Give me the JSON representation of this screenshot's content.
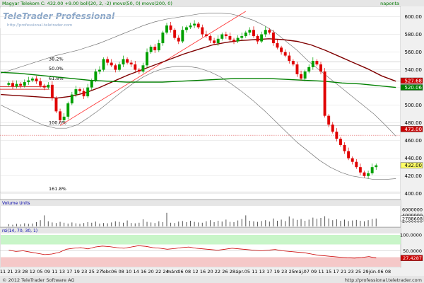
{
  "header": {
    "main_label": "Magyar Telekom C: 432.00 +9.00 boll(20, 2, -2) movs(50, 0) movs(200, 0)",
    "period": "naponta"
  },
  "watermark": {
    "brand": "TeleTrader Professional",
    "url": "http://professional.teletrader.com"
  },
  "panels": {
    "volume_label": "Volume Units",
    "rsi_label": "rsi(14, 70, 30, 1)"
  },
  "footer": {
    "copyright": "© 2012 TeleTrader Software AG",
    "url": "http://professional.teletrader.com"
  },
  "fib": [
    {
      "label": "38.2%",
      "value": 549
    },
    {
      "label": "50.0%",
      "value": 538
    },
    {
      "label": "61.8%",
      "value": 527
    },
    {
      "label": "100.0%",
      "value": 477
    },
    {
      "label": "161.8%",
      "value": 402
    }
  ],
  "value_tags": [
    {
      "label": "527.68",
      "value": 527.68,
      "color": "#cc0000"
    },
    {
      "label": "520.06",
      "value": 520.06,
      "color": "#008000"
    },
    {
      "label": "473.00",
      "value": 473.0,
      "color": "#cc0000"
    },
    {
      "label": "432.00",
      "value": 432.0,
      "color": "#ffff66"
    }
  ],
  "volume_tag": {
    "label": "2788608",
    "value": 2788608
  },
  "rsi_tag": {
    "label": "27.4287",
    "value": 27.43
  },
  "colors": {
    "up": "#00a000",
    "down": "#e00000",
    "ma50": "#800000",
    "ma200": "#008000",
    "bollinger": "#777777",
    "trend": "#ff3333",
    "rsi_band_high": "#c8f5c8",
    "rsi_band_low": "#f5c8c8"
  },
  "x_axis_labels": [
    "11",
    "21",
    "23",
    "28",
    "12",
    "05",
    "09",
    "11",
    "13",
    "17",
    "19",
    "23",
    "25",
    "27",
    "febr.",
    "06",
    "08",
    "10",
    "14",
    "16",
    "20",
    "22",
    "24",
    "márc.",
    "06",
    "08",
    "12",
    "16",
    "20",
    "22",
    "26",
    "28",
    "ápr.",
    "05",
    "11",
    "13",
    "17",
    "19",
    "23",
    "25",
    "máj.",
    "07",
    "09",
    "11",
    "15",
    "17",
    "21",
    "23",
    "25",
    "29",
    "jún.",
    "06",
    "08"
  ],
  "chart_data": [
    {
      "type": "candlestick",
      "title": "Magyar Telekom C: 432.00 +9.00 boll(20, 2, -2) movs(50, 0) movs(200, 0)",
      "ylim": [
        395,
        610
      ],
      "yticks": [
        400,
        420,
        440,
        460,
        480,
        500,
        520,
        540,
        560,
        580,
        600
      ],
      "close": [
        525,
        521,
        524,
        522,
        526,
        528,
        530,
        527,
        522,
        520,
        523,
        508,
        493,
        483,
        487,
        502,
        512,
        518,
        516,
        510,
        520,
        528,
        538,
        540,
        552,
        548,
        545,
        540,
        546,
        552,
        548,
        546,
        540,
        538,
        545,
        560,
        566,
        562,
        570,
        582,
        590,
        585,
        576,
        572,
        585,
        588,
        590,
        592,
        588,
        580,
        578,
        573,
        570,
        575,
        580,
        578,
        574,
        572,
        576,
        578,
        582,
        585,
        578,
        572,
        580,
        585,
        582,
        570,
        565,
        560,
        556,
        550,
        546,
        535,
        530,
        538,
        543,
        550,
        546,
        538,
        488,
        478,
        470,
        462,
        455,
        448,
        440,
        436,
        430,
        424,
        420,
        423,
        430,
        432
      ],
      "series": [
        {
          "name": "boll",
          "values": [
            536,
            540,
            544,
            548,
            552,
            556,
            559,
            562,
            566,
            570,
            575,
            580,
            585,
            590,
            594,
            597,
            599,
            601,
            603,
            604,
            604,
            603,
            600,
            596,
            590,
            582,
            572,
            562,
            550,
            540,
            530,
            520,
            510,
            500,
            490,
            478,
            465
          ]
        },
        {
          "name": "boll",
          "values": [
            500,
            494,
            488,
            482,
            477,
            474,
            474,
            478,
            486,
            495,
            505,
            515,
            524,
            532,
            538,
            542,
            544,
            544,
            542,
            538,
            532,
            524,
            515,
            505,
            494,
            482,
            470,
            458,
            448,
            438,
            430,
            424,
            420,
            418,
            416,
            416,
            417
          ]
        },
        {
          "name": "movs(50)",
          "values": [
            512,
            511,
            510,
            509,
            508,
            510,
            514,
            520,
            527,
            534,
            540,
            546,
            552,
            558,
            563,
            568,
            571,
            573,
            574,
            575,
            574,
            572,
            568,
            562,
            555,
            548,
            541,
            533,
            527
          ]
        },
        {
          "name": "movs(200)",
          "values": [
            537,
            536,
            534,
            532,
            530,
            528,
            527,
            526,
            526,
            526,
            527,
            528,
            529,
            530,
            530,
            530,
            529,
            528,
            527,
            525,
            524,
            522,
            520
          ]
        }
      ]
    },
    {
      "type": "bar",
      "title": "Volume Units",
      "ylim": [
        0,
        7000000
      ],
      "yticks": [
        2000000,
        4000000,
        6000000
      ],
      "values": [
        800000,
        600000,
        900000,
        700000,
        1100000,
        900000,
        1000000,
        1500000,
        2200000,
        3900000,
        1800000,
        1400000,
        1200000,
        1600000,
        1300000,
        1000000,
        1400000,
        1100000,
        900000,
        1200000,
        1500000,
        1300000,
        1700000,
        1000000,
        1200000,
        1100000,
        1400000,
        1800000,
        1600000,
        1300000,
        2100000,
        1200000,
        1100000,
        1300000,
        2500000,
        1600000,
        1400000,
        1200000,
        1800000,
        1500000,
        4800000,
        1300000,
        1200000,
        1700000,
        1900000,
        1500000,
        2000000,
        1600000,
        1400000,
        1300000,
        1800000,
        2200000,
        1500000,
        2000000,
        1700000,
        2400000,
        1600000,
        1500000,
        2100000,
        2600000,
        3900000,
        2000000,
        1800000,
        1600000,
        1900000,
        2200000,
        1700000,
        2800000,
        2000000,
        2400000,
        1900000,
        3500000,
        2800000,
        2300000,
        2600000,
        2000000,
        2400000,
        3100000,
        2700000,
        3000000,
        3600000,
        2800000,
        2200000,
        2500000,
        2000000,
        2400000,
        1900000,
        2100000,
        2300000,
        2000000,
        1800000,
        2200000,
        2600000,
        2788608
      ]
    },
    {
      "type": "line",
      "title": "rsi(14, 70, 30, 1)",
      "ylim": [
        0,
        100
      ],
      "yticks": [
        50,
        100
      ],
      "series": [
        {
          "name": "rsi",
          "values": [
            52,
            48,
            50,
            46,
            42,
            38,
            40,
            45,
            55,
            58,
            60,
            56,
            62,
            65,
            63,
            60,
            58,
            62,
            66,
            64,
            60,
            58,
            55,
            57,
            60,
            62,
            58,
            56,
            54,
            52,
            55,
            58,
            56,
            54,
            52,
            50,
            52,
            54,
            50,
            48,
            46,
            44,
            40,
            36,
            34,
            32,
            30,
            28,
            27,
            29,
            32,
            27.43
          ]
        }
      ]
    }
  ]
}
